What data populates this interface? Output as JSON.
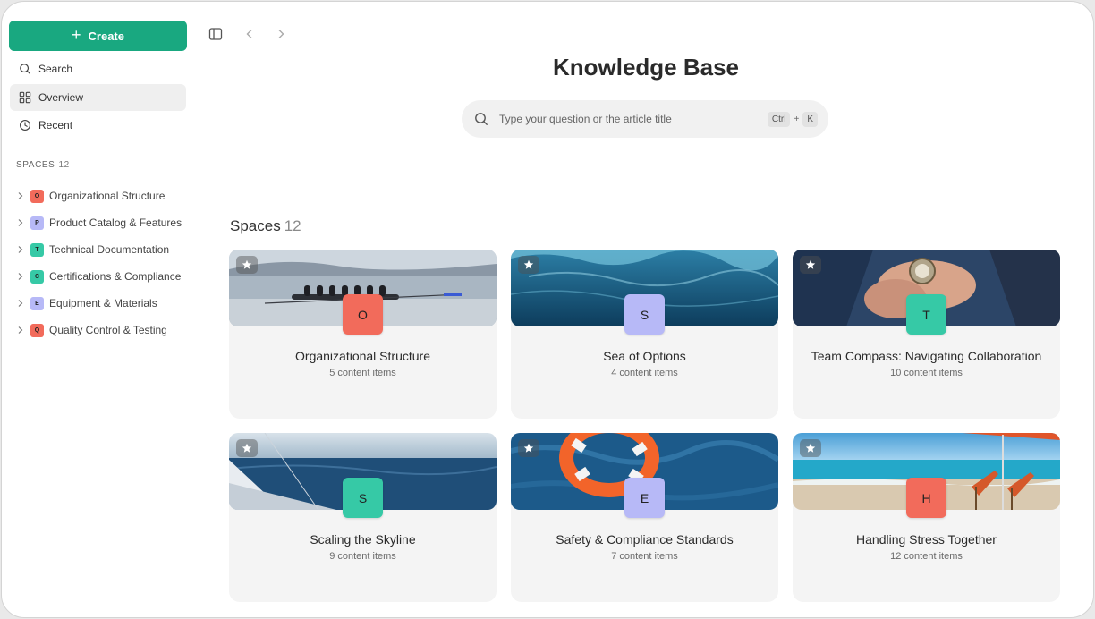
{
  "sidebar": {
    "create_label": "Create",
    "nav": [
      {
        "label": "Search",
        "icon": "search-icon"
      },
      {
        "label": "Overview",
        "icon": "grid-icon"
      },
      {
        "label": "Recent",
        "icon": "clock-icon"
      }
    ],
    "spaces_header": "SPACES",
    "spaces_count": "12",
    "spaces": [
      {
        "letter": "O",
        "label": "Organizational Structure",
        "color": "#f26b5b"
      },
      {
        "letter": "P",
        "label": "Product Catalog & Features",
        "color": "#b7b9f7"
      },
      {
        "letter": "T",
        "label": "Technical Documentation",
        "color": "#36c9a6"
      },
      {
        "letter": "C",
        "label": "Certifications & Compliance",
        "color": "#36c9a6"
      },
      {
        "letter": "E",
        "label": "Equipment & Materials",
        "color": "#b7b9f7"
      },
      {
        "letter": "Q",
        "label": "Quality Control & Testing",
        "color": "#f26b5b"
      }
    ]
  },
  "main": {
    "title": "Knowledge Base",
    "search_placeholder": "Type your question or the article title",
    "shortcut": {
      "key1": "Ctrl",
      "plus": "+",
      "key2": "K"
    },
    "section_title": "Spaces",
    "section_count": "12",
    "cards": [
      {
        "letter": "O",
        "title": "Organizational Structure",
        "subtitle": "5 content items",
        "color": "#f26b5b",
        "cover": "rowing-lake"
      },
      {
        "letter": "S",
        "title": "Sea of Options",
        "subtitle": "4 content items",
        "color": "#b7b9f7",
        "cover": "underwater"
      },
      {
        "letter": "T",
        "title": "Team Compass: Navigating Collaboration",
        "subtitle": "10 content items",
        "color": "#36c9a6",
        "cover": "compass-hands"
      },
      {
        "letter": "S",
        "title": "Scaling the Skyline",
        "subtitle": "9 content items",
        "color": "#36c9a6",
        "cover": "sailboat"
      },
      {
        "letter": "E",
        "title": "Safety & Compliance Standards",
        "subtitle": "7 content items",
        "color": "#b7b9f7",
        "cover": "lifebuoy"
      },
      {
        "letter": "H",
        "title": "Handling Stress Together",
        "subtitle": "12 content items",
        "color": "#f26b5b",
        "cover": "beach-chairs"
      }
    ]
  },
  "colors": {
    "accent": "#19a880"
  }
}
